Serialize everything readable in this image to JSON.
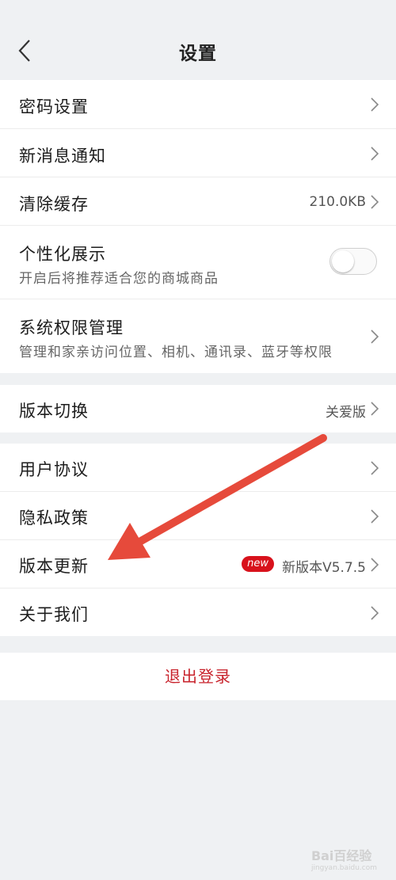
{
  "header": {
    "title": "设置"
  },
  "group1": {
    "password": {
      "label": "密码设置"
    },
    "notification": {
      "label": "新消息通知"
    },
    "cache": {
      "label": "清除缓存",
      "value": "210.0KB"
    },
    "personalized": {
      "label": "个性化展示",
      "sub": "开启后将推荐适合您的商城商品",
      "enabled": false
    },
    "permissions": {
      "label": "系统权限管理",
      "sub": "管理和家亲访问位置、相机、通讯录、蓝牙等权限"
    }
  },
  "group2": {
    "version_switch": {
      "label": "版本切换",
      "value": "关爱版"
    }
  },
  "group3": {
    "agreement": {
      "label": "用户协议"
    },
    "privacy": {
      "label": "隐私政策"
    },
    "update": {
      "label": "版本更新",
      "badge": "new",
      "value": "新版本V5.7.5"
    },
    "about": {
      "label": "关于我们"
    }
  },
  "logout": {
    "label": "退出登录"
  },
  "annotation": {
    "arrow_color": "#e64a3b"
  },
  "watermark": {
    "text": "Bai百经验",
    "sub": "jingyan.baidu.com"
  },
  "colors": {
    "background": "#eff1f3",
    "accent": "#c8232c",
    "badge": "#d8121c"
  },
  "icons": {
    "back": "chevron-left-icon",
    "row_arrow": "chevron-right-icon"
  }
}
